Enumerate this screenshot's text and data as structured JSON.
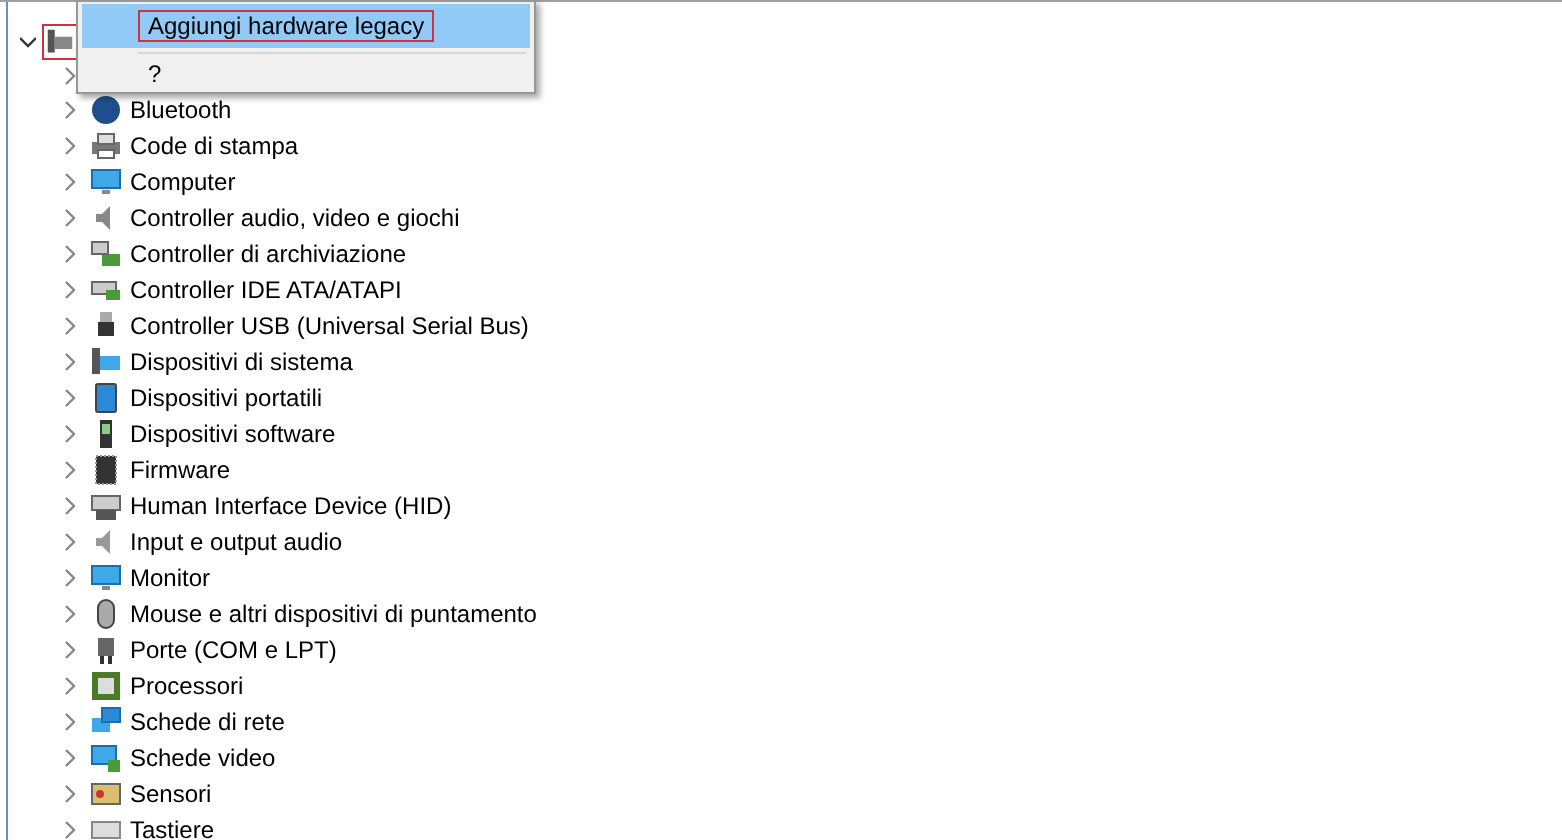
{
  "tree": {
    "expanded": true,
    "outlined": true,
    "children": [
      {
        "expanded": false
      },
      {
        "label": "Bluetooth",
        "expanded": false
      },
      {
        "label": "Code di stampa",
        "expanded": false
      },
      {
        "label": "Computer",
        "expanded": false
      },
      {
        "label": "Controller audio, video e giochi",
        "expanded": false
      },
      {
        "label": "Controller di archiviazione",
        "expanded": false
      },
      {
        "label": "Controller IDE ATA/ATAPI",
        "expanded": false
      },
      {
        "label": "Controller USB (Universal Serial Bus)",
        "expanded": false
      },
      {
        "label": "Dispositivi di sistema",
        "expanded": false
      },
      {
        "label": "Dispositivi portatili",
        "expanded": false
      },
      {
        "label": "Dispositivi software",
        "expanded": false
      },
      {
        "label": "Firmware",
        "expanded": false
      },
      {
        "label": "Human Interface Device (HID)",
        "expanded": false
      },
      {
        "label": "Input e output audio",
        "expanded": false
      },
      {
        "label": "Monitor",
        "expanded": false
      },
      {
        "label": "Mouse e altri dispositivi di puntamento",
        "expanded": false
      },
      {
        "label": "Porte (COM e LPT)",
        "expanded": false
      },
      {
        "label": "Processori",
        "expanded": false
      },
      {
        "label": "Schede di rete",
        "expanded": false
      },
      {
        "label": "Schede video",
        "expanded": false
      },
      {
        "label": "Sensori",
        "expanded": false
      },
      {
        "label": "Tastiere",
        "expanded": false
      }
    ]
  },
  "context_menu": {
    "items": [
      {
        "label": "Aggiungi hardware legacy",
        "selected": true,
        "outlined": true
      },
      {
        "label": "?",
        "selected": false,
        "outlined": false
      }
    ]
  }
}
